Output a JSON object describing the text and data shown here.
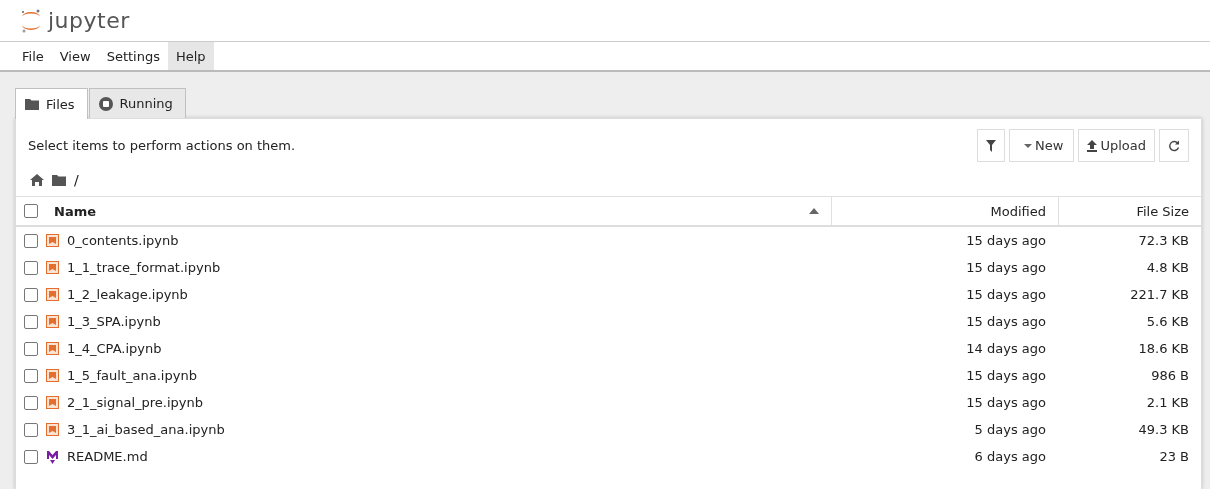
{
  "logo": {
    "text": "jupyter"
  },
  "menu": [
    {
      "label": "File",
      "selected": false
    },
    {
      "label": "View",
      "selected": false
    },
    {
      "label": "Settings",
      "selected": false
    },
    {
      "label": "Help",
      "selected": true
    }
  ],
  "tabs": [
    {
      "label": "Files",
      "kind": "files",
      "selected": true
    },
    {
      "label": "Running",
      "kind": "running",
      "selected": false
    }
  ],
  "hint": "Select items to perform actions on them.",
  "toolbar": {
    "new": "New",
    "upload": "Upload"
  },
  "breadcrumb": "/",
  "table": {
    "columns": [
      "Name",
      "Modified",
      "File Size"
    ],
    "select_all_checked": false,
    "rows": [
      {
        "name": "0_contents.ipynb",
        "kind": "notebook",
        "modified": "15 days ago",
        "size": "72.3 KB",
        "checked": false
      },
      {
        "name": "1_1_trace_format.ipynb",
        "kind": "notebook",
        "modified": "15 days ago",
        "size": "4.8 KB",
        "checked": false
      },
      {
        "name": "1_2_leakage.ipynb",
        "kind": "notebook",
        "modified": "15 days ago",
        "size": "221.7 KB",
        "checked": false
      },
      {
        "name": "1_3_SPA.ipynb",
        "kind": "notebook",
        "modified": "15 days ago",
        "size": "5.6 KB",
        "checked": false
      },
      {
        "name": "1_4_CPA.ipynb",
        "kind": "notebook",
        "modified": "14 days ago",
        "size": "18.6 KB",
        "checked": false
      },
      {
        "name": "1_5_fault_ana.ipynb",
        "kind": "notebook",
        "modified": "15 days ago",
        "size": "986 B",
        "checked": false
      },
      {
        "name": "2_1_signal_pre.ipynb",
        "kind": "notebook",
        "modified": "15 days ago",
        "size": "2.1 KB",
        "checked": false
      },
      {
        "name": "3_1_ai_based_ana.ipynb",
        "kind": "notebook",
        "modified": "5 days ago",
        "size": "49.3 KB",
        "checked": false
      },
      {
        "name": "README.md",
        "kind": "markdown",
        "modified": "6 days ago",
        "size": "23 B",
        "checked": false
      }
    ]
  }
}
